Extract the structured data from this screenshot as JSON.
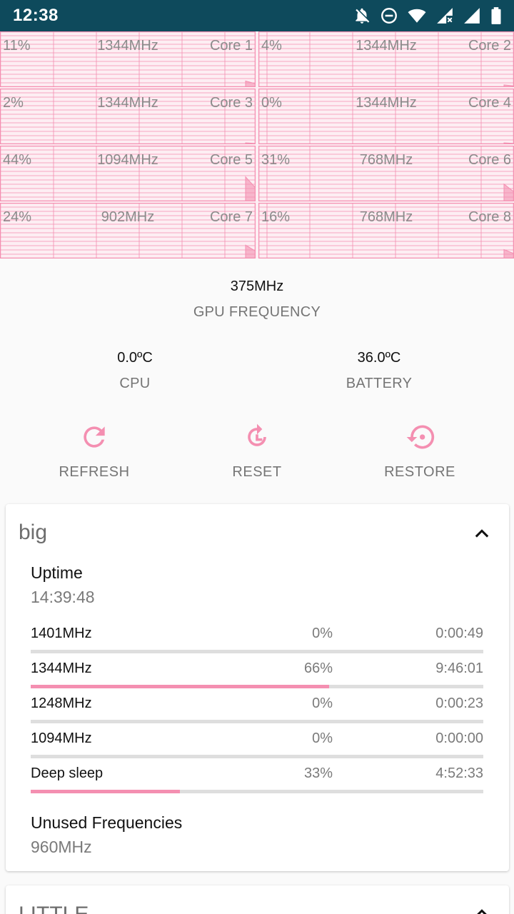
{
  "status_bar": {
    "time": "12:38",
    "icons": [
      "notifications-off-icon",
      "do-not-disturb-icon",
      "wifi-icon",
      "cellular-no-data-icon",
      "cellular-icon",
      "battery-icon"
    ]
  },
  "cores": [
    {
      "load": "11%",
      "freq": "1344MHz",
      "name": "Core 1"
    },
    {
      "load": "4%",
      "freq": "1344MHz",
      "name": "Core 2"
    },
    {
      "load": "2%",
      "freq": "1344MHz",
      "name": "Core 3"
    },
    {
      "load": "0%",
      "freq": "1344MHz",
      "name": "Core 4"
    },
    {
      "load": "44%",
      "freq": "1094MHz",
      "name": "Core 5"
    },
    {
      "load": "31%",
      "freq": "768MHz",
      "name": "Core 6"
    },
    {
      "load": "24%",
      "freq": "902MHz",
      "name": "Core 7"
    },
    {
      "load": "16%",
      "freq": "768MHz",
      "name": "Core 8"
    }
  ],
  "gpu": {
    "value": "375MHz",
    "label": "GPU FREQUENCY"
  },
  "temps": {
    "cpu": {
      "value": "0.0ºC",
      "label": "CPU"
    },
    "battery": {
      "value": "36.0ºC",
      "label": "BATTERY"
    }
  },
  "actions": {
    "refresh": "REFRESH",
    "reset": "RESET",
    "restore": "RESTORE"
  },
  "big": {
    "title": "big",
    "uptime_label": "Uptime",
    "uptime_value": "14:39:48",
    "rows": [
      {
        "freq": "1401MHz",
        "pct": "0%",
        "time": "0:00:49",
        "fraction": 0.0
      },
      {
        "freq": "1344MHz",
        "pct": "66%",
        "time": "9:46:01",
        "fraction": 0.66
      },
      {
        "freq": "1248MHz",
        "pct": "0%",
        "time": "0:00:23",
        "fraction": 0.0
      },
      {
        "freq": "1094MHz",
        "pct": "0%",
        "time": "0:00:00",
        "fraction": 0.0
      },
      {
        "freq": "Deep sleep",
        "pct": "33%",
        "time": "4:52:33",
        "fraction": 0.33
      }
    ],
    "unused_label": "Unused Frequencies",
    "unused_value": "960MHz"
  },
  "little": {
    "title": "LITTLE"
  },
  "colors": {
    "accent": "#f48fb1",
    "status_bar": "#0e4a5c",
    "grid": "#f48fb1"
  }
}
